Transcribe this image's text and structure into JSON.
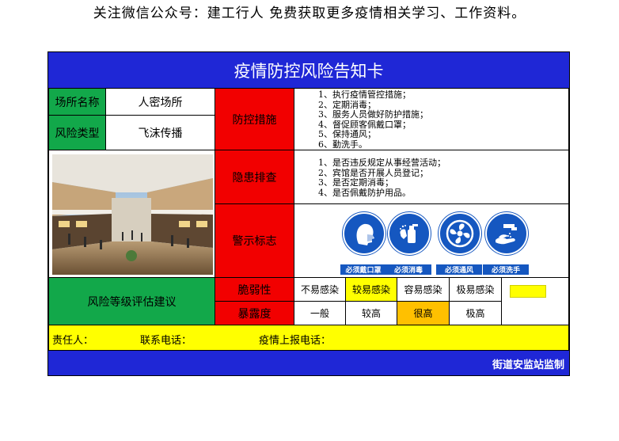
{
  "banner": "关注微信公众号：建工行人  免费获取更多疫情相关学习、工作资料。",
  "title": "疫情防控风险告知卡",
  "place": {
    "label": "场所名称",
    "value": "人密场所"
  },
  "risk_type": {
    "label": "风险类型",
    "value": "飞沫传播"
  },
  "measures": {
    "label": "防控措施",
    "items": [
      "1、执行疫情管控措施；",
      "2、定期消毒；",
      "3、服务人员做好防护措施；",
      "4、督促顾客佩戴口罩；",
      "5、保持通风；",
      "6、勤洗手。"
    ]
  },
  "hazard": {
    "label": "隐患排查",
    "items": [
      "1、是否违反规定从事经营活动；",
      "2、宾馆是否开展人员登记；",
      "3、是否定期消毒；",
      "4、是否佩戴防护用品。"
    ]
  },
  "warning": {
    "label": "警示标志",
    "signs": [
      {
        "icon": "mask-head-icon",
        "label": "必须戴口罩"
      },
      {
        "icon": "disinfect-spray-icon",
        "label": "必须消毒"
      },
      {
        "icon": "fan-ventilation-icon",
        "label": "必须通风"
      },
      {
        "icon": "hand-wash-icon",
        "label": "必须洗手"
      }
    ]
  },
  "assessment": {
    "label": "风险等级评估建议",
    "vulnerability": {
      "label": "脆弱性",
      "levels": [
        "不易感染",
        "较易感染",
        "容易感染",
        "极易感染"
      ],
      "highlighted": "较易感染"
    },
    "exposure": {
      "label": "暴露度",
      "levels": [
        "一般",
        "较高",
        "很高",
        "极高"
      ],
      "highlighted": "很高"
    }
  },
  "footer": {
    "responsible": "责任人：",
    "phone": "联系电话：",
    "report_phone": "疫情上报电话："
  },
  "supervision": "街道安监站监制",
  "colors": {
    "blue": "#1f27d6",
    "green": "#12a84a",
    "red": "#f20000",
    "yellow": "#ffff00",
    "orange": "#ffc000",
    "sign_blue": "#1557c0"
  }
}
